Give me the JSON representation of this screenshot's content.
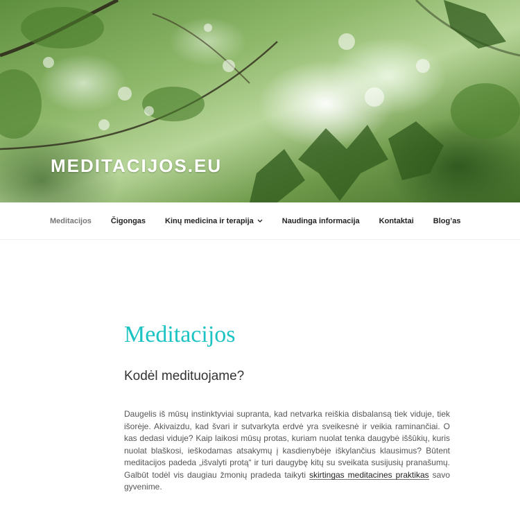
{
  "header": {
    "site_title": "MEDITACIJOS.EU"
  },
  "nav": {
    "items": [
      {
        "label": "Meditacijos",
        "current": true
      },
      {
        "label": "Čigongas",
        "current": false
      },
      {
        "label": "Kinų medicina ir terapija",
        "current": false,
        "has_dropdown": true
      },
      {
        "label": "Naudinga informacija",
        "current": false
      },
      {
        "label": "Kontaktai",
        "current": false
      },
      {
        "label": "Blog’as",
        "current": false
      }
    ],
    "dropdown_icon": "chevron-down-icon"
  },
  "main": {
    "title": "Meditacijos",
    "subheading": "Kodėl medituojame?",
    "paragraph_text": "Daugelis iš mūsų instinktyviai supranta, kad netvarka reiškia disbalansą tiek viduje, tiek išorėje. Akivaizdu, kad švari ir sutvarkyta erdvė yra sveikesnė ir veikia raminančiai. O kas dedasi viduje? Kaip laikosi mūsų protas, kuriam nuolat tenka daugybė iššūkių, kuris nuolat blaškosi, ieškodamas atsakymų į kasdienybėje iškylančius klausimus? Būtent meditacijos padeda „išvalyti protą“ ir turi daugybę kitų su sveikata susijusių pranašumų. Galbūt todėl vis daugiau žmonių pradeda taikyti ",
    "paragraph_link": "skirtingas meditacines praktikas",
    "paragraph_end": " savo gyvenime."
  },
  "colors": {
    "title_accent": "#1cc3c3",
    "text": "#333333",
    "nav_current": "#767676"
  }
}
